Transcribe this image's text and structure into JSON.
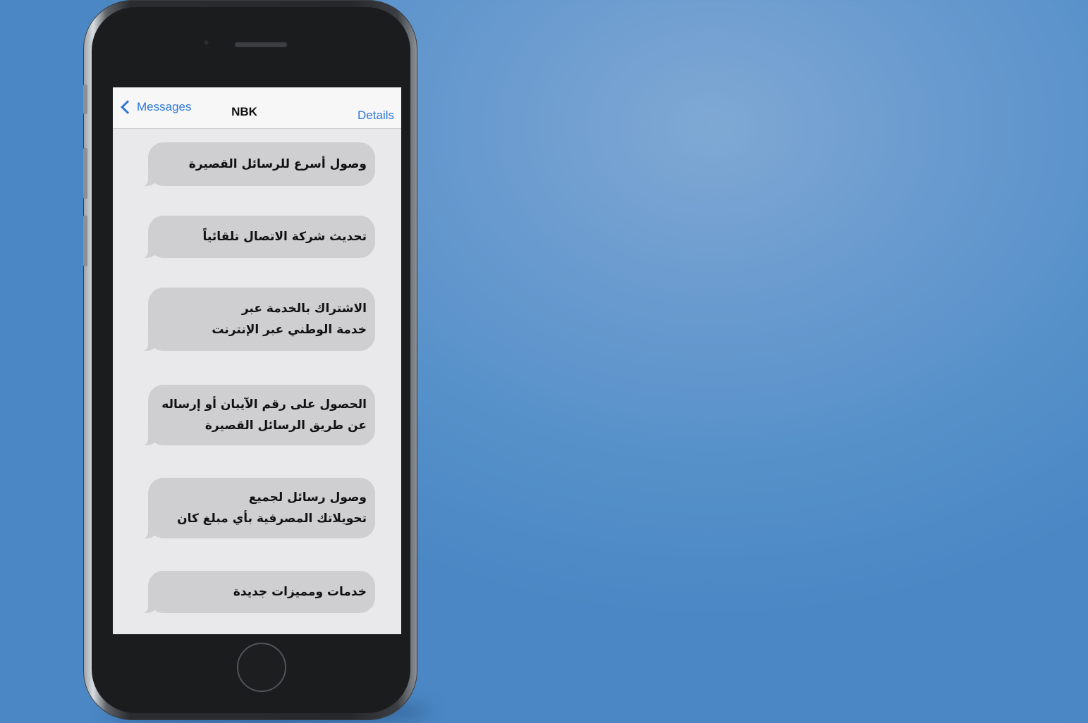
{
  "navbar": {
    "back_label": "Messages",
    "title": "NBK",
    "details_label": "Details"
  },
  "messages": [
    {
      "text": "وصول أسرع للرسائل القصيرة"
    },
    {
      "text": "تحديث شركة الاتصال تلقائياً"
    },
    {
      "text": "الاشتراك بالخدمة عبر\nخدمة الوطني عبر الإنترنت"
    },
    {
      "text": "الحصول على رقم الآيبان أو إرساله\nعن طريق الرسائل القصيرة"
    },
    {
      "text": "وصول رسائل لجميع\nتحويلاتك المصرفية بأي مبلغ كان"
    },
    {
      "text": "خدمات ومميزات جديدة"
    }
  ],
  "colors": {
    "background": "#5590c9",
    "link": "#2f78d6",
    "bubble": "#cfcfd2"
  }
}
